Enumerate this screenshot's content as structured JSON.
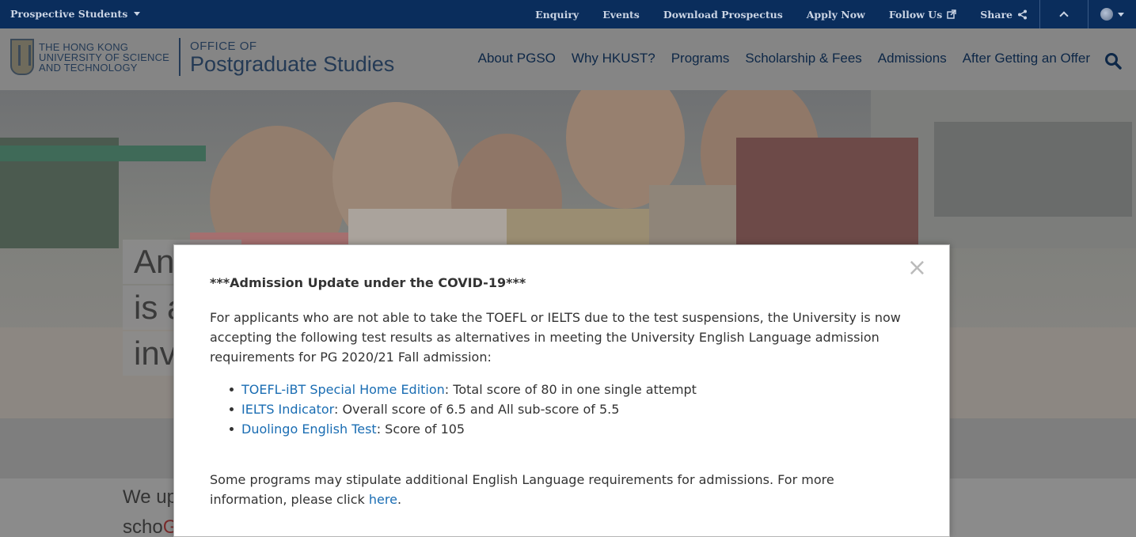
{
  "topbar": {
    "audience": "Prospective Students",
    "links": [
      "Enquiry",
      "Events",
      "Download Prospectus",
      "Apply Now",
      "Follow Us",
      "Share"
    ]
  },
  "header": {
    "university_lines": [
      "THE HONG KONG",
      "UNIVERSITY OF SCIENCE",
      "AND TECHNOLOGY"
    ],
    "office_small": "OFFICE OF",
    "office_big": "Postgraduate Studies",
    "nav": [
      "About PGSO",
      "Why HKUST?",
      "Programs",
      "Scholarship & Fees",
      "Admissions",
      "After Getting an Offer"
    ]
  },
  "hero": {
    "tagline_lines": [
      "An",
      "is a",
      "inv"
    ]
  },
  "lower": {
    "line1": "We up",
    "line2": "scho",
    "line2_highlight": "Glo"
  },
  "modal": {
    "close_glyph": "×",
    "title": "***Admission Update under the COVID-19***",
    "intro": "For applicants who are not able to take the TOEFL or IELTS due to the test suspensions, the University is now accepting the following test results as alternatives in meeting the University English Language admission requirements for PG 2020/21 Fall admission:",
    "items": [
      {
        "link": "TOEFL-iBT Special Home Edition",
        "text": ": Total score of 80 in one single attempt"
      },
      {
        "link": "IELTS Indicator",
        "text": ": Overall score of 6.5 and All sub-score of 5.5"
      },
      {
        "link": "Duolingo English Test",
        "text": ": Score of 105"
      }
    ],
    "note_before": "Some programs may stipulate additional English Language requirements for admissions. For more information, please click ",
    "note_link": "here",
    "note_after": "."
  },
  "colors": {
    "topbar_bg": "#0a2d5c",
    "link": "#1a6db3",
    "overlay_gray": "#858585"
  }
}
